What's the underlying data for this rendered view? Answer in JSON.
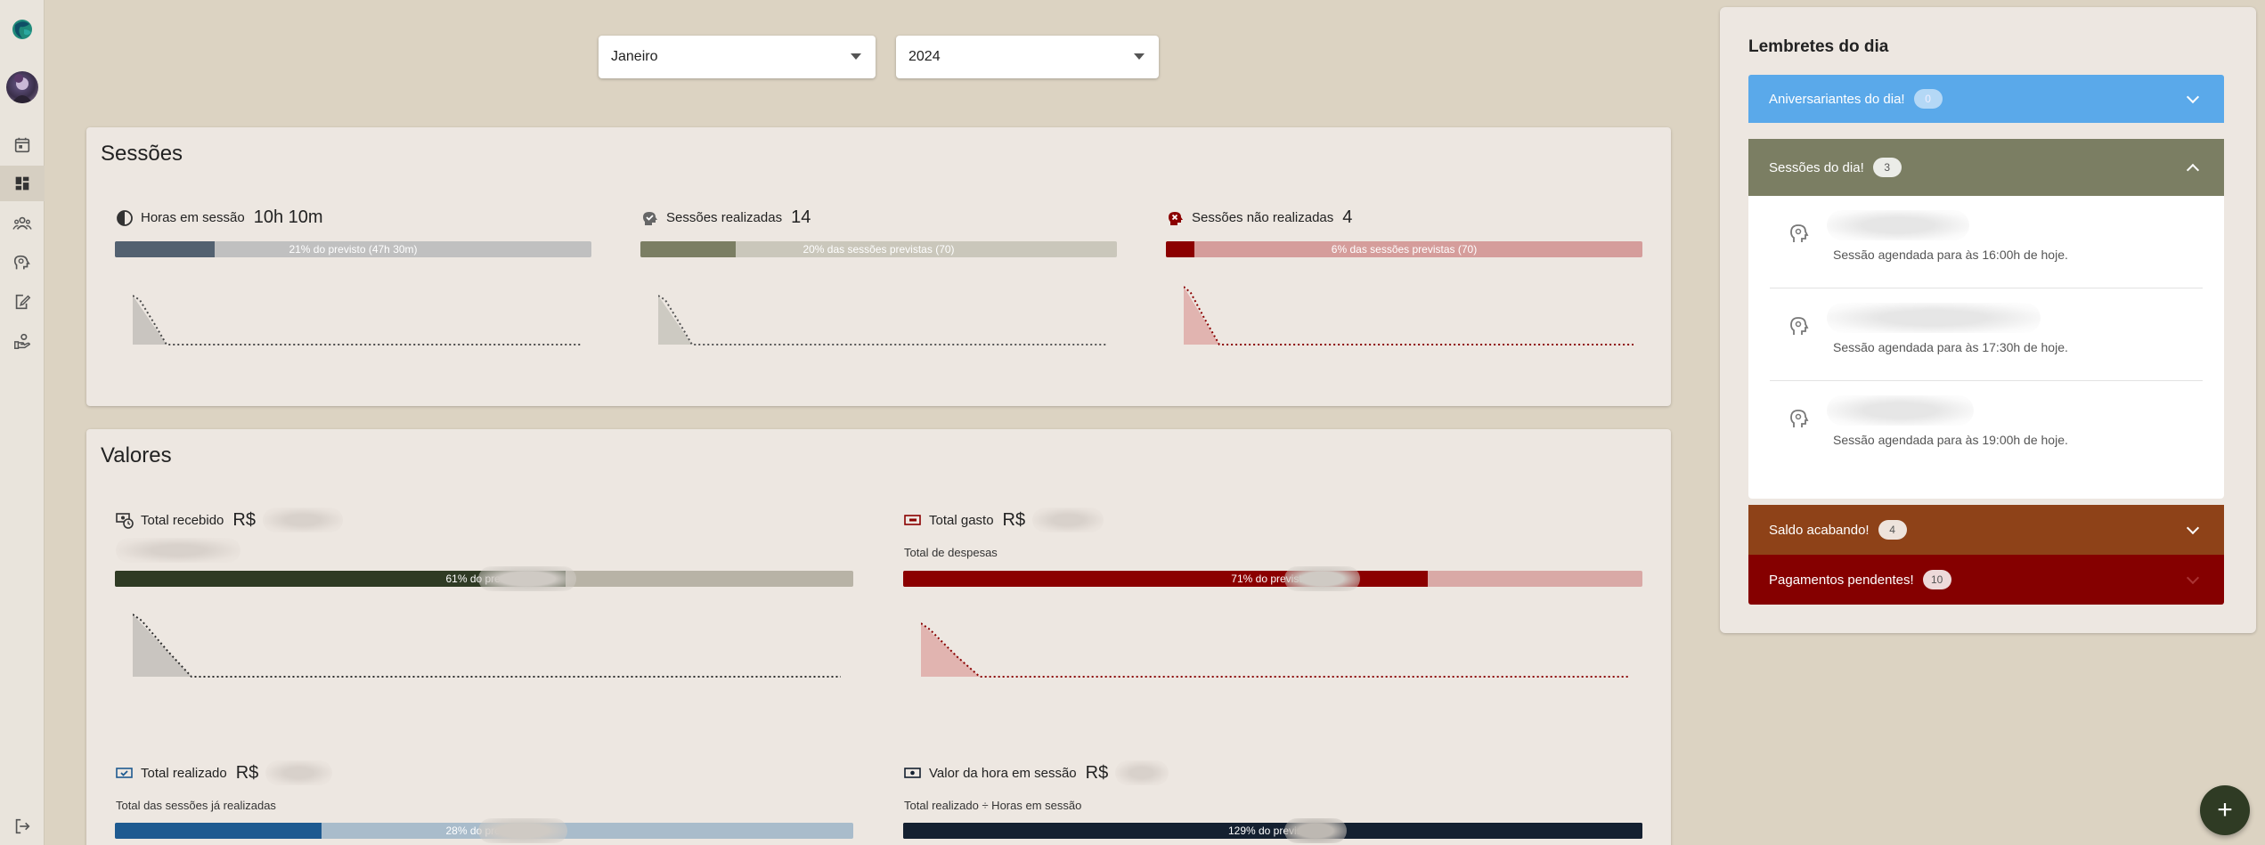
{
  "filters": {
    "month": "Janeiro",
    "year": "2024"
  },
  "sessions_card": {
    "title": "Sessões",
    "hours": {
      "label": "Horas em sessão",
      "value": "10h 10m",
      "bar_text": "21% do previsto (47h 30m)",
      "progress_pct": 21,
      "color": "#536170",
      "track": "#c0c0c0"
    },
    "done": {
      "label": "Sessões realizadas",
      "value": "14",
      "bar_text": "20% das sessões previstas (70)",
      "progress_pct": 20,
      "color": "#7b7e63",
      "track": "#cac7bb"
    },
    "not_done": {
      "label": "Sessões não realizadas",
      "value": "4",
      "bar_text": "6% das sessões previstas (70)",
      "progress_pct": 6,
      "color": "#8b0000",
      "track": "#d59d9b"
    }
  },
  "values_card": {
    "title": "Valores",
    "currency": "R$",
    "received": {
      "label": "Total recebido",
      "bar_text": "61% do previsto",
      "progress_pct": 61,
      "color": "#2f3b24",
      "track": "#b8b3a6"
    },
    "spent": {
      "label": "Total gasto",
      "sub": "Total de despesas",
      "bar_text": "71% do previsto (",
      "progress_pct": 71,
      "color": "#8b0000",
      "track": "#d9a9a6"
    },
    "realized": {
      "label": "Total realizado",
      "sub": "Total das sessões já realizadas",
      "bar_text": "28% do previsto",
      "progress_pct": 28,
      "color": "#1e5a90",
      "track": "#a9bccb"
    },
    "hour_value": {
      "label": "Valor da hora em sessão",
      "sub": "Total realizado ÷ Horas em sessão",
      "bar_text": "129% do previsto (",
      "progress_pct": 100,
      "color": "#142030",
      "track": "#142030"
    }
  },
  "reminders": {
    "title": "Lembretes do dia",
    "birthdays": {
      "label": "Aniversariantes do dia!",
      "count": "0",
      "color": "#5aa9ea"
    },
    "sessions": {
      "label": "Sessões do dia!",
      "count": "3",
      "color": "#7b7e63",
      "items": [
        {
          "text": "Sessão agendada para às 16:00h de hoje."
        },
        {
          "text": "Sessão agendada para às 17:30h de hoje."
        },
        {
          "text": "Sessão agendada para às 19:00h de hoje."
        }
      ]
    },
    "low_balance": {
      "label": "Saldo acabando!",
      "count": "4",
      "color": "#8e4218"
    },
    "pending": {
      "label": "Pagamentos pendentes!",
      "count": "10",
      "color": "#850000"
    }
  },
  "fab": {
    "label": "+"
  },
  "icons": {
    "nav": [
      "calendar-icon",
      "dashboard-icon",
      "patients-icon",
      "psychology-icon",
      "edit-document-icon",
      "finance-icon"
    ],
    "logout": "logout-icon"
  }
}
